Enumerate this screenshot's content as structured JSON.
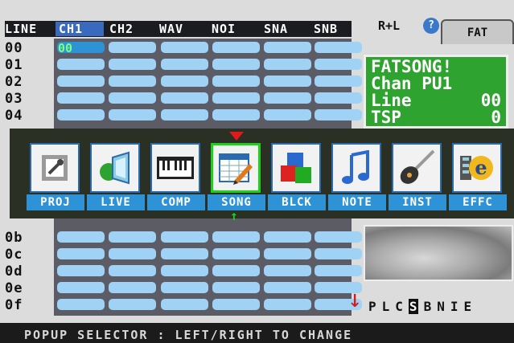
{
  "header": {
    "line_label": "LINE",
    "channels": [
      "CH1",
      "CH2",
      "WAV",
      "NOI",
      "SNA",
      "SNB"
    ]
  },
  "rows": [
    "00",
    "01",
    "02",
    "03",
    "04",
    "0b",
    "0c",
    "0d",
    "0e",
    "0f"
  ],
  "selected_cell_value": "00",
  "right_panel": {
    "rl_label": "R+L",
    "help_icon": "?",
    "tab_label": "FAT",
    "info_lines": [
      {
        "left": "FATSONG!",
        "right": ""
      },
      {
        "left": "Chan PU1",
        "right": ""
      },
      {
        "left": "Line",
        "right": "00"
      },
      {
        "left": "TSP",
        "right": "0"
      }
    ],
    "scroll_arrow": "↓",
    "screen_letters": [
      "P",
      "L",
      "C",
      "S",
      "B",
      "N",
      "I",
      "E"
    ],
    "selected_letter": "S"
  },
  "popup": {
    "items": [
      {
        "label": "PROJ",
        "icon": "proj-icon"
      },
      {
        "label": "LIVE",
        "icon": "speaker-icon"
      },
      {
        "label": "COMP",
        "icon": "keyboard-icon"
      },
      {
        "label": "SONG",
        "icon": "song-icon"
      },
      {
        "label": "BLCK",
        "icon": "blocks-icon"
      },
      {
        "label": "NOTE",
        "icon": "note-icon"
      },
      {
        "label": "INST",
        "icon": "guitar-icon"
      },
      {
        "label": "EFFC",
        "icon": "effect-icon"
      }
    ],
    "selected_index": 3
  },
  "status_bar": "POPUP SELECTOR : LEFT/RIGHT TO CHANGE",
  "colors": {
    "accent": "#2e93d6",
    "selection": "#19d219",
    "panel_bg": "#2a3023",
    "info_green": "#2fa32f"
  }
}
